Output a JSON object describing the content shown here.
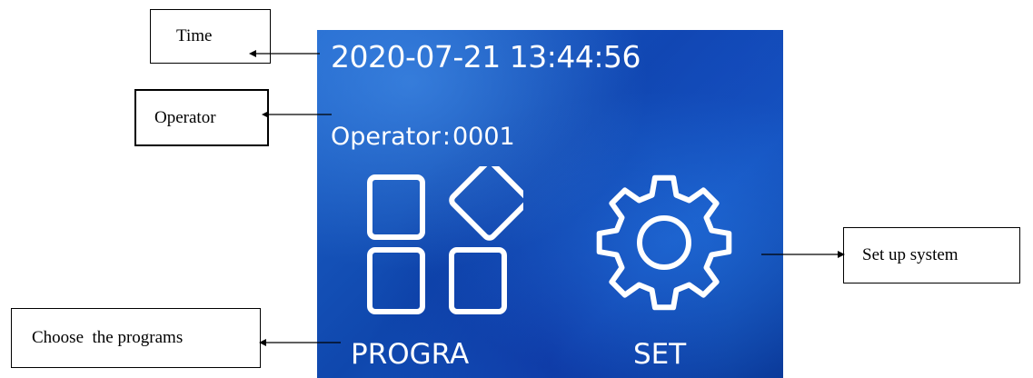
{
  "callouts": {
    "time": "Time",
    "operator": "Operator",
    "set_up_system": "Set up system",
    "choose_programs": "Choose  the programs"
  },
  "screen": {
    "datetime": "2020-07-21 13:44:56",
    "operator_label": "Operator",
    "operator_separator": ":",
    "operator_value": "0001",
    "program_button": {
      "label": "PROGRA",
      "icon": "apps-grid-icon"
    },
    "set_button": {
      "label": "SET",
      "icon": "gear-icon"
    }
  },
  "colors": {
    "screen_blue": "#1659c2",
    "foreground": "#ffffff"
  }
}
